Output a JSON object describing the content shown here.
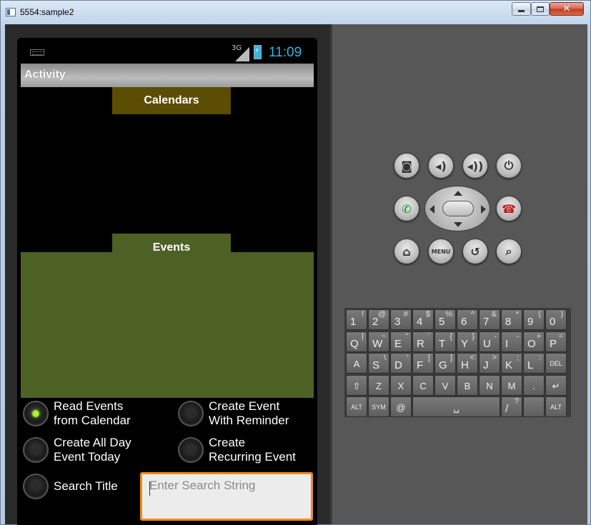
{
  "window": {
    "title": "5554:sample2",
    "close_glyph": "✕"
  },
  "status_bar": {
    "network": "3G",
    "clock": "11:09"
  },
  "action_bar": {
    "title": "Activity"
  },
  "tabs": {
    "calendars": "Calendars",
    "events": "Events"
  },
  "options": [
    {
      "label": "Read Events\nfrom Calendar",
      "selected": true
    },
    {
      "label": "Create Event\nWith Reminder",
      "selected": false
    },
    {
      "label": "Create All Day\nEvent Today",
      "selected": false
    },
    {
      "label": "Create\nRecurring Event",
      "selected": false
    },
    {
      "label": "Search Title",
      "selected": false
    }
  ],
  "search": {
    "placeholder": "Enter Search String"
  },
  "controls": {
    "camera": "camera-icon",
    "vol_down": "volume-down-icon",
    "vol_up": "volume-up-icon",
    "power": "power-icon",
    "call": "call-icon",
    "end_call": "end-call-icon",
    "home": "home-icon",
    "menu_label": "MENU",
    "back": "back-icon",
    "search": "search-icon"
  },
  "keyboard": {
    "row1": [
      [
        "1",
        "!"
      ],
      [
        "2",
        "@"
      ],
      [
        "3",
        "#"
      ],
      [
        "4",
        "$"
      ],
      [
        "5",
        "%"
      ],
      [
        "6",
        "^"
      ],
      [
        "7",
        "&"
      ],
      [
        "8",
        "*"
      ],
      [
        "9",
        "("
      ],
      [
        "0",
        ")"
      ]
    ],
    "row2": [
      [
        "Q",
        "|"
      ],
      [
        "W",
        "~"
      ],
      [
        "E",
        "\""
      ],
      [
        "R",
        "`"
      ],
      [
        "T",
        "{"
      ],
      [
        "Y",
        "}"
      ],
      [
        "U",
        "-"
      ],
      [
        "I",
        "-"
      ],
      [
        "O",
        "+"
      ],
      [
        "P",
        "="
      ]
    ],
    "row3": [
      [
        "A",
        ""
      ],
      [
        "S",
        "\\"
      ],
      [
        "D",
        "'"
      ],
      [
        "F",
        "["
      ],
      [
        "G",
        "]"
      ],
      [
        "H",
        "<"
      ],
      [
        "J",
        ">"
      ],
      [
        "K",
        ";"
      ],
      [
        "L",
        ":"
      ]
    ],
    "row3_del": "DEL",
    "row4": [
      "Z",
      "X",
      "C",
      "V",
      "B",
      "N",
      "M",
      "."
    ],
    "row5": {
      "alt": "ALT",
      "sym": "SYM",
      "at": "@",
      "slash": "/",
      "slash_shift": "?",
      "alt2": "ALT"
    }
  },
  "colors": {
    "calendars_tab": "#5b4d04",
    "events_tab": "#4d6125",
    "clock": "#33b5e5",
    "focus": "#f08c14"
  }
}
